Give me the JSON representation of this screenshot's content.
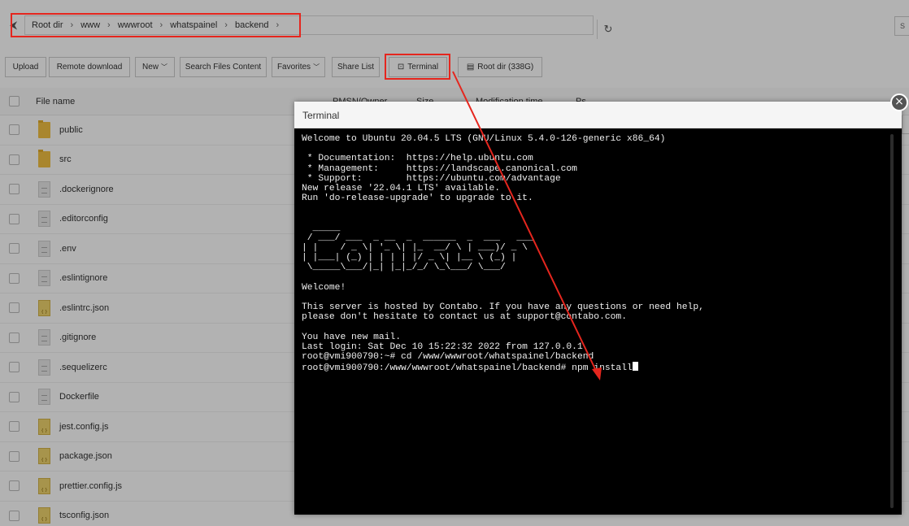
{
  "breadcrumb": {
    "items": [
      "Root dir",
      "www",
      "wwwroot",
      "whatspainel",
      "backend"
    ],
    "separator": "›"
  },
  "toolbar": {
    "upload": "Upload",
    "remote_download": "Remote download",
    "new": "New",
    "search_files_content": "Search Files Content",
    "favorites": "Favorites",
    "share_list": "Share List",
    "terminal": "Terminal",
    "root_dir": "Root dir (338G)"
  },
  "table": {
    "headers": {
      "file_name": "File name",
      "perm_owner": "PMSN/Owner",
      "size": "Size",
      "modification_time": "Modification time",
      "ps": "Ps"
    },
    "rows": [
      {
        "name": "public",
        "type": "folder"
      },
      {
        "name": "src",
        "type": "folder"
      },
      {
        "name": ".dockerignore",
        "type": "file"
      },
      {
        "name": ".editorconfig",
        "type": "file"
      },
      {
        "name": ".env",
        "type": "file"
      },
      {
        "name": ".eslintignore",
        "type": "file"
      },
      {
        "name": ".eslintrc.json",
        "type": "json"
      },
      {
        "name": ".gitignore",
        "type": "file"
      },
      {
        "name": ".sequelizerc",
        "type": "file"
      },
      {
        "name": "Dockerfile",
        "type": "file"
      },
      {
        "name": "jest.config.js",
        "type": "json"
      },
      {
        "name": "package.json",
        "type": "json"
      },
      {
        "name": "prettier.config.js",
        "type": "json"
      },
      {
        "name": "tsconfig.json",
        "type": "json"
      }
    ]
  },
  "terminal": {
    "title": "Terminal",
    "lines": [
      "Welcome to Ubuntu 20.04.5 LTS (GNU/Linux 5.4.0-126-generic x86_64)",
      "",
      " * Documentation:  https://help.ubuntu.com",
      " * Management:     https://landscape.canonical.com",
      " * Support:        https://ubuntu.com/advantage",
      "New release '22.04.1 LTS' available.",
      "Run 'do-release-upgrade' to upgrade to it.",
      "",
      "",
      "  _____",
      " / ___/ ___  _ __  _  ______  _  ___   ___",
      "| |    / _ \\| '_ \\| |_  __/ \\ | ___)/ _ \\",
      "| |___| (_) | | | | |/ _ \\| |__ \\ (_) |",
      " \\_____\\___/|_| |_|_/_/ \\_\\___/ \\___/",
      "",
      "Welcome!",
      "",
      "This server is hosted by Contabo. If you have any questions or need help,",
      "please don't hesitate to contact us at support@contabo.com.",
      "",
      "You have new mail.",
      "Last login: Sat Dec 10 15:22:32 2022 from 127.0.0.1",
      "root@vmi900790:~# cd /www/wwwroot/whatspainel/backend",
      "root@vmi900790:/www/wwwroot/whatspainel/backend# npm install"
    ]
  },
  "colors": {
    "annotation_red": "#e5261e",
    "folder": "#f2c043",
    "terminal_bg": "#000000"
  }
}
